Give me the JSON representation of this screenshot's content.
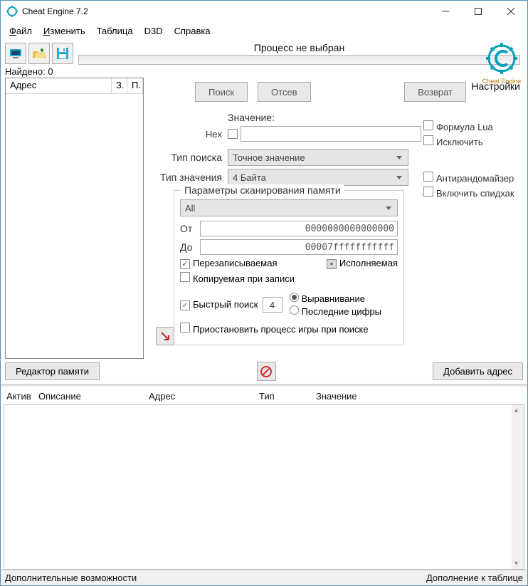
{
  "window": {
    "title": "Cheat Engine 7.2"
  },
  "menu": {
    "file": "Файл",
    "edit": "Изменить",
    "table": "Таблица",
    "d3d": "D3D",
    "help": "Справка"
  },
  "toolbar": {
    "process_label": "Процесс не выбран",
    "logo_text": "Cheat Engine",
    "settings": "Настройки"
  },
  "found": {
    "label": "Найдено:",
    "count": "0"
  },
  "listhead": {
    "address": "Адрес",
    "z": "З.",
    "p": "П."
  },
  "buttons": {
    "search": "Поиск",
    "filter": "Отсев",
    "back": "Возврат",
    "mem_editor": "Редактор памяти",
    "add_address": "Добавить адрес"
  },
  "form": {
    "value_label": "Значение:",
    "hex_label": "Hex",
    "search_type_label": "Тип поиска",
    "search_type_value": "Точное значение",
    "value_type_label": "Тип значения",
    "value_type_value": "4 Байта",
    "lua_formula": "Формула Lua",
    "exclude": "Исключить",
    "antirandom": "Антирандомайзер",
    "speedhack": "Включить спидхак"
  },
  "scan": {
    "legend": "Параметры сканирования памяти",
    "all": "All",
    "from_label": "От",
    "from_value": "0000000000000000",
    "to_label": "До",
    "to_value": "00007fffffffffff",
    "writable": "Перезаписываемая",
    "executable": "Исполняемая",
    "cow": "Копируемая при записи",
    "fast_search": "Быстрый поиск",
    "fast_value": "4",
    "alignment": "Выравнивание",
    "last_digits": "Последние цифры",
    "pause_game": "Приостановить процесс игры при поиске"
  },
  "table": {
    "active": "Актив",
    "desc": "Описание",
    "address": "Адрес",
    "type": "Тип",
    "value": "Значение"
  },
  "status": {
    "left": "Дополнительные возможности",
    "right": "Дополнение к таблице"
  }
}
